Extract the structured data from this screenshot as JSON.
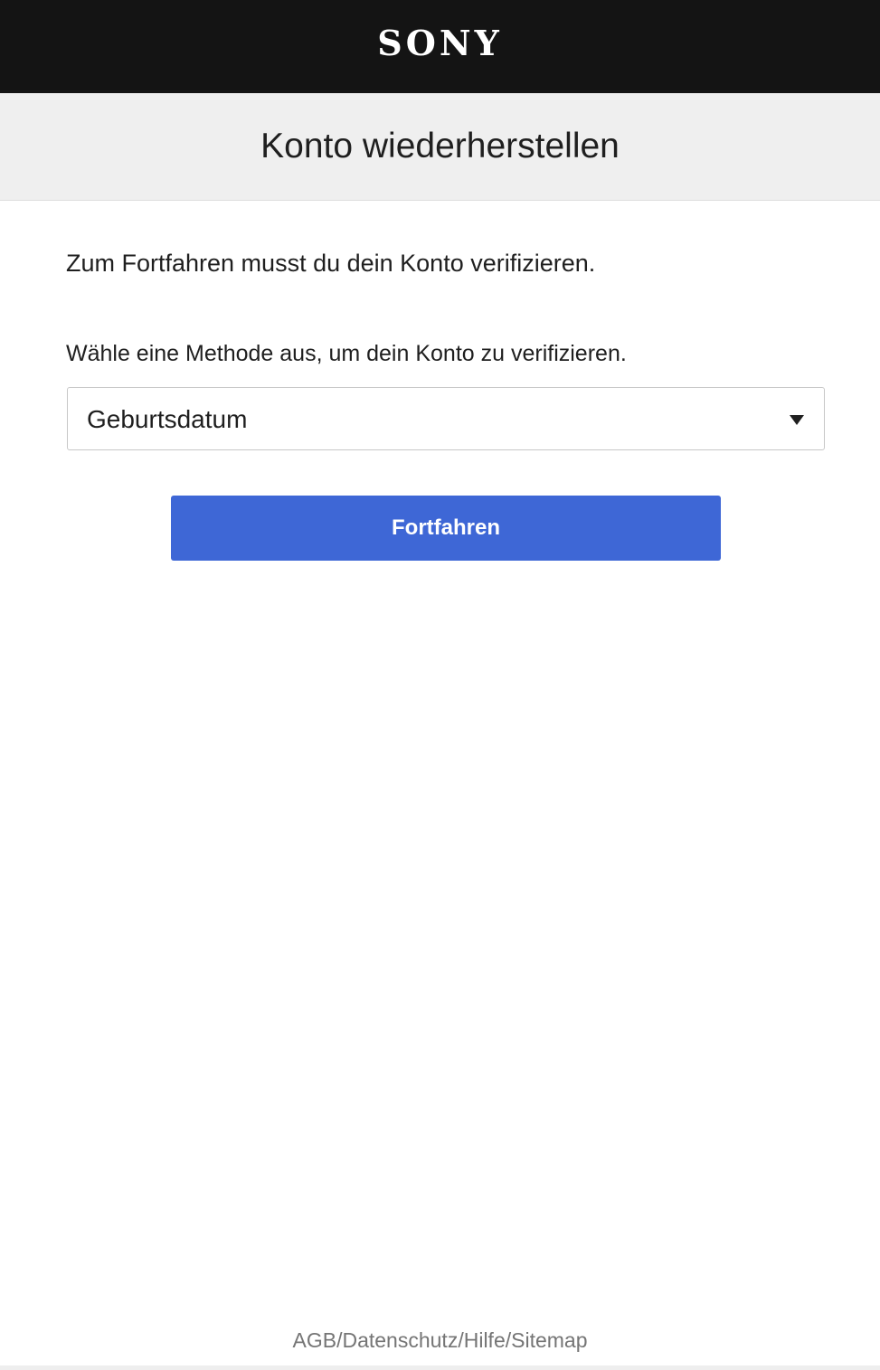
{
  "header": {
    "logo_text": "SONY"
  },
  "page": {
    "title": "Konto wiederherstellen"
  },
  "main": {
    "intro": "Zum Fortfahren musst du dein Konto verifizieren.",
    "method_label": "Wähle eine Methode aus, um dein Konto zu verifizieren.",
    "method_select": {
      "selected": "Geburtsdatum"
    },
    "continue_label": "Fortfahren"
  },
  "footer": {
    "links": [
      "AGB",
      "Datenschutz",
      "Hilfe",
      "Sitemap"
    ],
    "separator": "/"
  },
  "colors": {
    "header_bg": "#141414",
    "title_bar_bg": "#efefef",
    "button_bg": "#3e67d6",
    "footer_text": "#757575"
  },
  "icons": {
    "dropdown": "caret-down-icon"
  }
}
